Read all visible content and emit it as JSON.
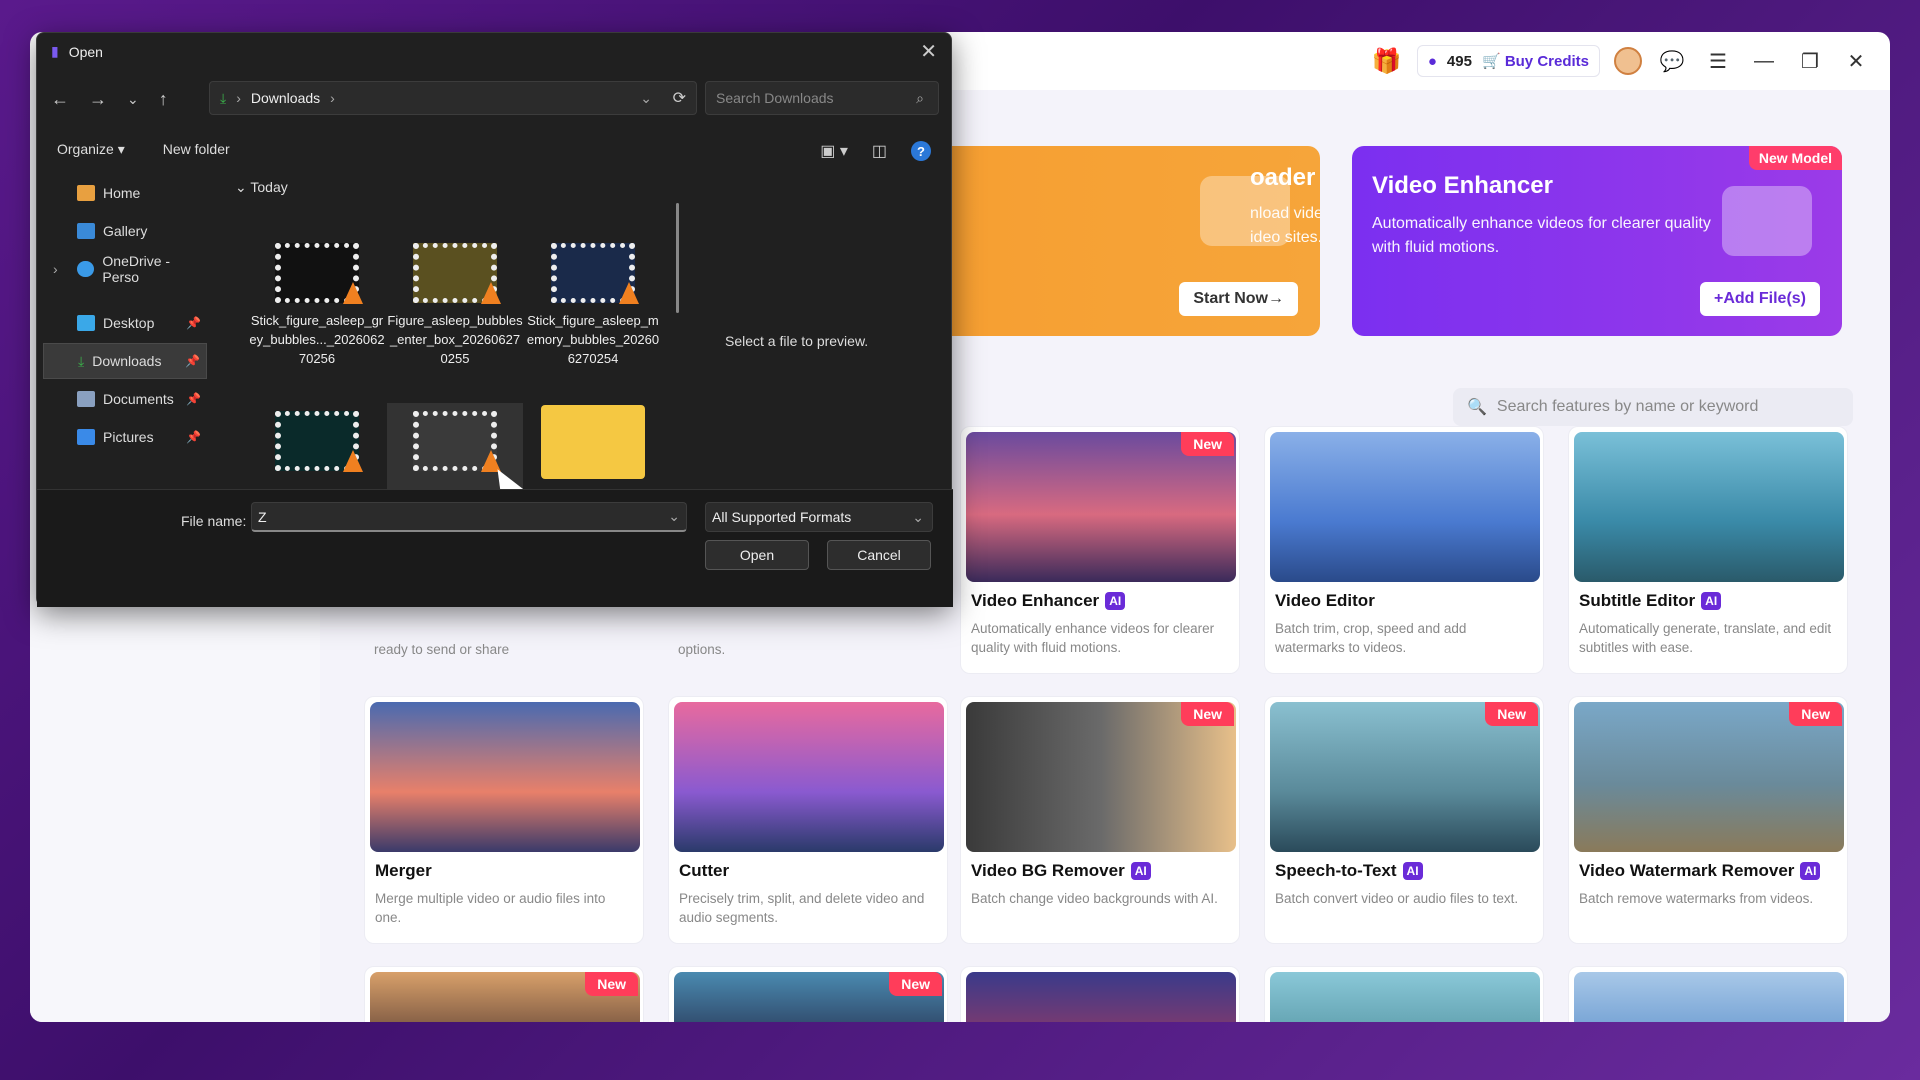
{
  "topbar": {
    "credits": "495",
    "buy_label": "Buy Credits"
  },
  "banners": [
    {
      "title": "Downloader",
      "title_visible": "oader",
      "desc": "Download video and audio files from video sites.",
      "desc_visible": "nload video and audio files from ideo sites.",
      "button": "Start Now→"
    },
    {
      "title": "Video Enhancer",
      "desc": "Automatically enhance videos for clearer quality with fluid motions.",
      "button": "+Add File(s)",
      "badge": "New Model"
    }
  ],
  "feature_search": {
    "placeholder": "Search features by name or keyword"
  },
  "cards_hidden_row": [
    {
      "desc_tail": "ready to send or share"
    },
    {
      "desc_tail": "options."
    }
  ],
  "cards": [
    {
      "title": "Video Enhancer",
      "ai": "AI",
      "new": "New",
      "desc": "Automatically enhance videos for clearer quality with fluid motions."
    },
    {
      "title": "Video Editor",
      "ai": "",
      "new": "",
      "desc": "Batch trim, crop, speed and add watermarks to videos."
    },
    {
      "title": "Subtitle Editor",
      "ai": "AI",
      "new": "",
      "desc": "Automatically generate, translate, and edit subtitles with ease."
    },
    {
      "title": "Merger",
      "ai": "",
      "new": "",
      "desc": "Merge multiple video or audio files into one."
    },
    {
      "title": "Cutter",
      "ai": "",
      "new": "",
      "desc": "Precisely trim, split, and delete video and audio segments."
    },
    {
      "title": "Video BG Remover",
      "ai": "AI",
      "new": "New",
      "desc": "Batch change video backgrounds with AI."
    },
    {
      "title": "Speech-to-Text",
      "ai": "AI",
      "new": "New",
      "desc": "Batch convert video or audio files to text."
    },
    {
      "title": "Video Watermark Remover",
      "ai": "AI",
      "new": "New",
      "desc": "Batch remove watermarks from videos."
    }
  ],
  "badges": {
    "new": "New"
  },
  "dialog": {
    "title": "Open",
    "path": "Downloads",
    "search_placeholder": "Search Downloads",
    "organize": "Organize ▾",
    "new_folder": "New folder",
    "nav": [
      {
        "label": "Home"
      },
      {
        "label": "Gallery"
      },
      {
        "label": "OneDrive - Perso"
      },
      {
        "label": "Desktop"
      },
      {
        "label": "Downloads"
      },
      {
        "label": "Documents"
      },
      {
        "label": "Pictures"
      }
    ],
    "group": "Today",
    "files": [
      {
        "name": "Stick_figure_asleep_grey_bubbles..._202606270256"
      },
      {
        "name": "Figure_asleep_bubbles_enter_box_202606270255"
      },
      {
        "name": "Stick_figure_asleep_memory_bubbles_202606270254"
      }
    ],
    "preview_text": "Select a file to preview.",
    "file_name_label": "File name:",
    "file_name_value": "Z",
    "format": "All Supported Formats",
    "open_button": "Open",
    "cancel_button": "Cancel"
  },
  "colors": {
    "accent": "#6a2bd8",
    "new_badge": "#ff3d5a",
    "orange_banner": "#f79a2b"
  }
}
